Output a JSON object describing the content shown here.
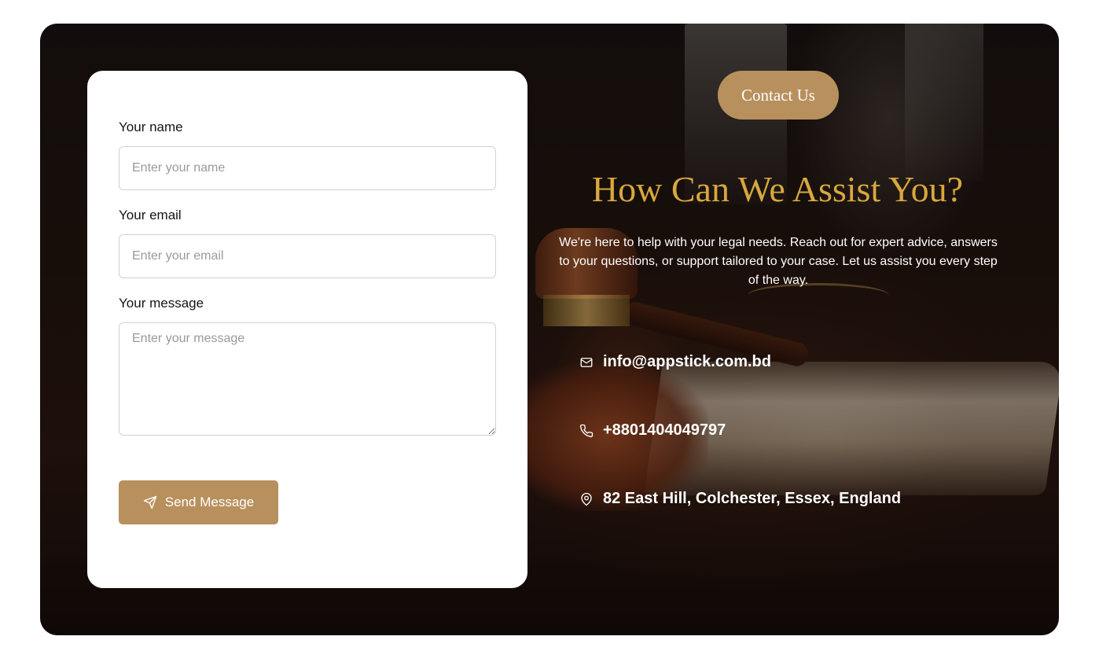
{
  "form": {
    "name_label": "Your name",
    "name_placeholder": "Enter your name",
    "email_label": "Your email",
    "email_placeholder": "Enter your email",
    "message_label": "Your message",
    "message_placeholder": "Enter your message",
    "submit_label": "Send Message",
    "submit_icon": "send-icon"
  },
  "info": {
    "badge_label": "Contact Us",
    "heading": "How Can We Assist You?",
    "description": "We're here to help with your legal needs. Reach out for expert advice, answers to your questions, or support tailored to your case. Let us assist you every step of the way.",
    "email": "info@appstick.com.bd",
    "phone": "+8801404049797",
    "address": "82 East Hill, Colchester, Essex, England"
  },
  "colors": {
    "accent": "#b8905d",
    "heading": "#d8a83e",
    "background_dark": "#1e120d"
  }
}
